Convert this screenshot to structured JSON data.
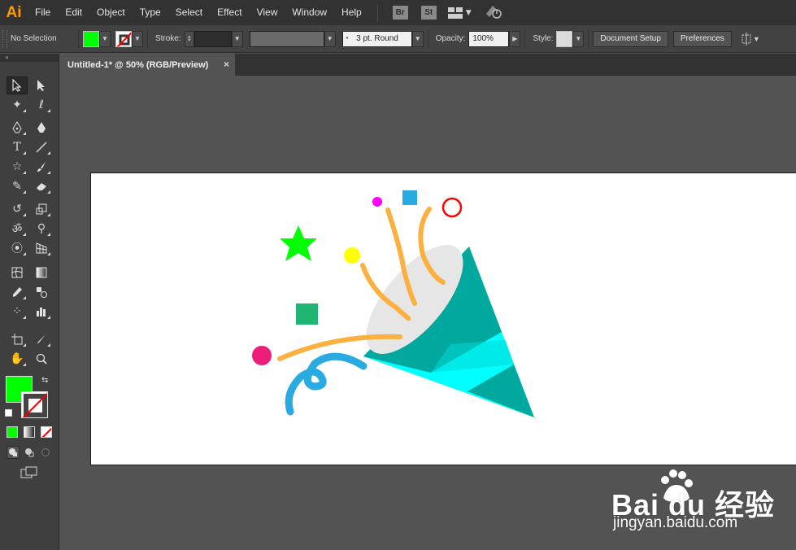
{
  "app": {
    "logo": "Ai"
  },
  "menu": [
    "File",
    "Edit",
    "Object",
    "Type",
    "Select",
    "Effect",
    "View",
    "Window",
    "Help"
  ],
  "app_buttons": {
    "bridge": "Br",
    "stock": "St"
  },
  "control_bar": {
    "selection_status": "No Selection",
    "fill_color": "#00ff00",
    "stroke_label": "Stroke:",
    "brush_value": "3 pt. Round",
    "opacity_label": "Opacity:",
    "opacity_value": "100%",
    "style_label": "Style:",
    "document_setup_label": "Document Setup",
    "preferences_label": "Preferences"
  },
  "document_tab": {
    "title": "Untitled-1* @ 50% (RGB/Preview)",
    "close": "×"
  },
  "tools_panel": {
    "collapse_label": "«",
    "fill_color": "#00ff00",
    "stroke_color": "none"
  },
  "artwork": {
    "colors": {
      "cone_light": "#00ffff",
      "cone_dark": "#00a89e",
      "cone_mid": "#00d8d8",
      "cone_top": "#e6e6e6",
      "streamer_orange": "#fbb040",
      "streamer_blue": "#29abe2",
      "star": "#00ff00",
      "square_green": "#21b573",
      "square_blue": "#29abe2",
      "dot_yellow": "#ffff00",
      "dot_magenta": "#ff00ff",
      "dot_pink": "#ed1e79",
      "ring_red": "#ff0000"
    }
  },
  "watermark": {
    "brand": "Bai  du 经验",
    "url": "jingyan.baidu.com"
  }
}
